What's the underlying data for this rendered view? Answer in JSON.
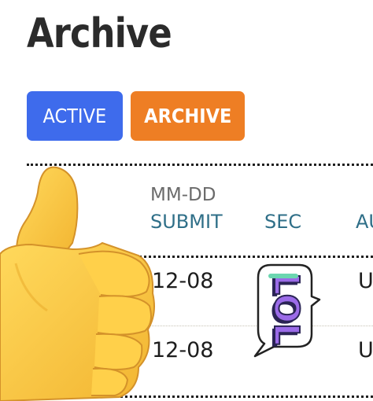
{
  "page": {
    "title": "Archive"
  },
  "tabs": [
    {
      "label": "ACTIVE",
      "color": "#3e6bec",
      "selected": false
    },
    {
      "label": "ARCHIVE",
      "color": "#ee7e24",
      "selected": true
    }
  ],
  "table": {
    "date_format": "MM-DD",
    "columns": [
      "SUBMIT",
      "SEC",
      "AU"
    ],
    "rows": [
      {
        "submit": "12-08",
        "sec": "",
        "au": "U"
      },
      {
        "submit": "12-08",
        "sec": "",
        "au": "U"
      }
    ]
  },
  "icons": {
    "thumb": "thumbs-up-icon",
    "sticker": "lol-sticker-icon"
  },
  "colors": {
    "header_text": "#2f6f88"
  }
}
